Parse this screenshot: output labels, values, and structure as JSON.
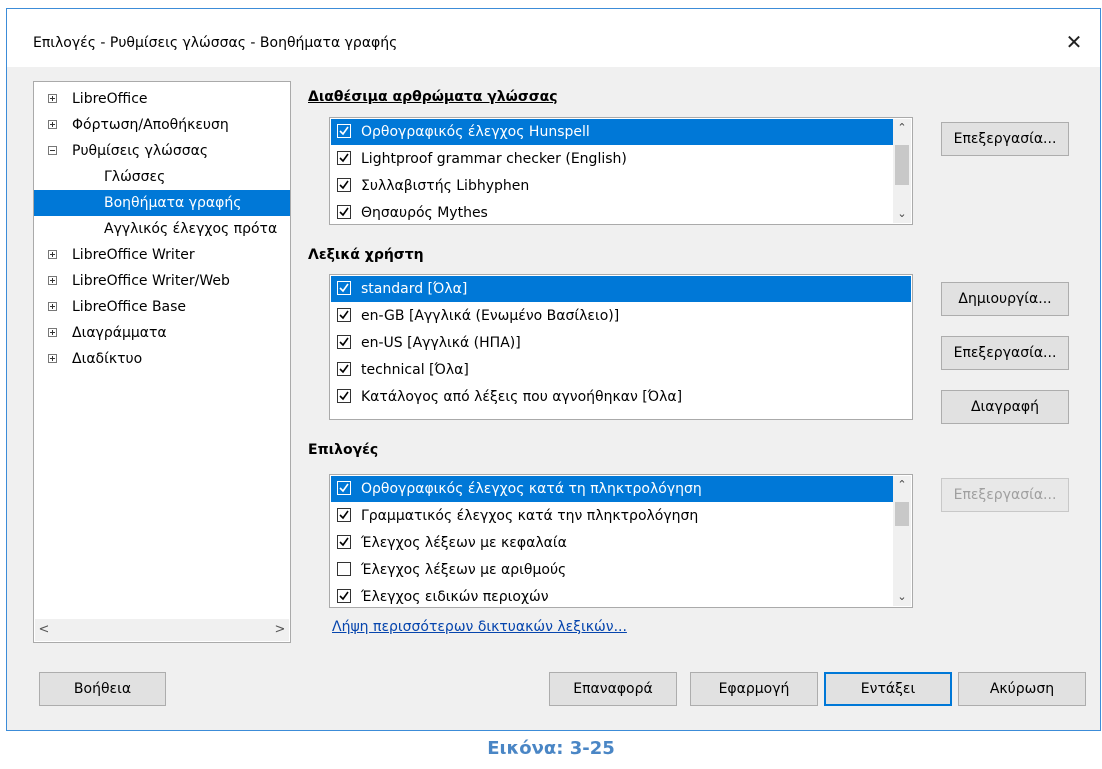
{
  "window": {
    "title": "Επιλογές - Ρυθμίσεις γλώσσας - Βοηθήματα γραφής"
  },
  "tree": {
    "items": [
      {
        "label": "LibreOffice",
        "expander": "plus"
      },
      {
        "label": "Φόρτωση/Αποθήκευση",
        "expander": "plus"
      },
      {
        "label": "Ρυθμίσεις γλώσσας",
        "expander": "minus"
      },
      {
        "label": "Γλώσσες",
        "expander": ""
      },
      {
        "label": "Βοηθήματα γραφής",
        "expander": "",
        "selected": true
      },
      {
        "label": "Αγγλικός έλεγχος πρότα",
        "expander": ""
      },
      {
        "label": "LibreOffice Writer",
        "expander": "plus"
      },
      {
        "label": "LibreOffice Writer/Web",
        "expander": "plus"
      },
      {
        "label": "LibreOffice Base",
        "expander": "plus"
      },
      {
        "label": "Διαγράμματα",
        "expander": "plus"
      },
      {
        "label": "Διαδίκτυο",
        "expander": "plus"
      }
    ],
    "scroll_left": "<",
    "scroll_right": ">"
  },
  "modules": {
    "title": "Διαθέσιμα αρθρώματα γλώσσας",
    "items": [
      {
        "label": "Ορθογραφικός έλεγχος Hunspell",
        "checked": true
      },
      {
        "label": "Lightproof grammar checker (English)",
        "checked": true
      },
      {
        "label": "Συλλαβιστής Libhyphen",
        "checked": true
      },
      {
        "label": "Θησαυρός Mythes",
        "checked": true
      }
    ],
    "edit_button": "Επεξεργασία..."
  },
  "dictionaries": {
    "title": "Λεξικά χρήστη",
    "items": [
      {
        "label": "standard [Όλα]",
        "checked": true
      },
      {
        "label": "en-GB [Αγγλικά (Ενωμένο Βασίλειο)]",
        "checked": true
      },
      {
        "label": "en-US [Αγγλικά (ΗΠΑ)]",
        "checked": true
      },
      {
        "label": "technical [Όλα]",
        "checked": true
      },
      {
        "label": "Κατάλογος από λέξεις που αγνοήθηκαν [Όλα]",
        "checked": true
      }
    ],
    "new_button": "Δημιουργία...",
    "edit_button": "Επεξεργασία...",
    "delete_button": "Διαγραφή"
  },
  "options": {
    "title": "Επιλογές",
    "items": [
      {
        "label": "Ορθογραφικός έλεγχος κατά τη πληκτρολόγηση",
        "checked": true
      },
      {
        "label": "Γραμματικός έλεγχος κατά την πληκτρολόγηση",
        "checked": true
      },
      {
        "label": "Έλεγχος λέξεων με κεφαλαία",
        "checked": true
      },
      {
        "label": "Έλεγχος λέξεων με αριθμούς",
        "checked": false
      },
      {
        "label": "Έλεγχος ειδικών περιοχών",
        "checked": true
      }
    ],
    "edit_button": "Επεξεργασία..."
  },
  "more_dicts_link": "Λήψη περισσότερων δικτυακών λεξικών...",
  "footer": {
    "help": "Βοήθεια",
    "reset": "Επαναφορά",
    "apply": "Εφαρμογή",
    "ok": "Εντάξει",
    "cancel": "Ακύρωση"
  },
  "caption": "Εικόνα: 3-25"
}
